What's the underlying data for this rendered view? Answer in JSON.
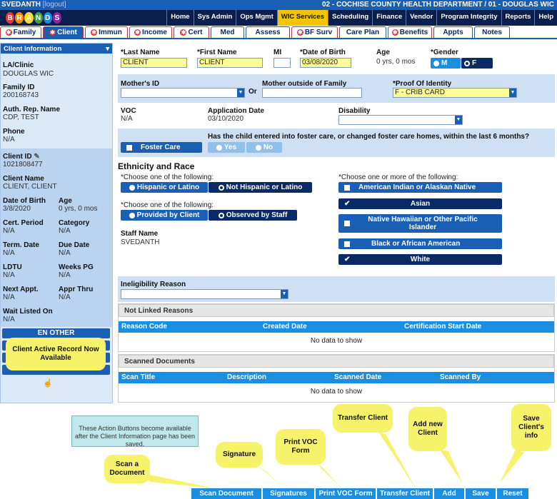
{
  "topbar": {
    "user": "SVEDANTH",
    "user_link": "[logout]",
    "org": "02 - COCHISE COUNTY HEALTH DEPARTMENT / 01 - DOUGLAS WIC"
  },
  "logo_letters": [
    "B",
    "R",
    "A",
    "N",
    "D",
    "S"
  ],
  "logo_colors": [
    "#e53935",
    "#fb8c00",
    "#fdd835",
    "#43a047",
    "#1e88e5",
    "#8e24aa"
  ],
  "mainnav": [
    "Home",
    "Sys Admin",
    "Ops Mgmt",
    "WIC Services",
    "Scheduling",
    "Finance",
    "Vendor",
    "Program Integrity",
    "Reports",
    "Help"
  ],
  "tabs": [
    {
      "label": "Family",
      "req": true
    },
    {
      "label": "Client",
      "req": true,
      "active": true
    },
    {
      "label": "Immun",
      "req": true
    },
    {
      "label": "Income",
      "req": true
    },
    {
      "label": "Cert",
      "req": true
    },
    {
      "label": "Med",
      "req": false
    },
    {
      "label": "Assess",
      "req": false
    },
    {
      "label": "BF Surv",
      "req": true
    },
    {
      "label": "Care Plan",
      "req": false
    },
    {
      "label": "Benefits",
      "req": true
    },
    {
      "label": "Appts",
      "req": false
    },
    {
      "label": "Notes",
      "req": false
    }
  ],
  "sidebar": {
    "title": "Client Information",
    "laclinic_label": "LA/Clinic",
    "laclinic": "DOUGLAS WIC",
    "familyid_label": "Family ID",
    "familyid": "200168743",
    "authrep_label": "Auth. Rep. Name",
    "authrep": "CDP, TEST",
    "phone_label": "Phone",
    "phone": "N/A",
    "clientid_label": "Client ID",
    "clientid": "1021808477",
    "clientname_label": "Client Name",
    "clientname": "CLIENT, CLIENT",
    "dob_label": "Date of Birth",
    "dob": "3/8/2020",
    "age_label": "Age",
    "age": "0 yrs, 0 mos",
    "certperiod_label": "Cert. Period",
    "certperiod": "N/A",
    "category_label": "Category",
    "category": "N/A",
    "termdate_label": "Term. Date",
    "termdate": "N/A",
    "duedate_label": "Due Date",
    "duedate": "N/A",
    "ldtu_label": "LDTU",
    "ldtu": "N/A",
    "weekspg_label": "Weeks PG",
    "weekspg": "N/A",
    "nextappt_label": "Next Appt.",
    "nextappt": "N/A",
    "apprthru_label": "Appr Thru",
    "apprthru": "N/A",
    "waitlist_label": "Wait Listed On",
    "waitlist": "N/A",
    "another_label": "EN   OTHER"
  },
  "form": {
    "lastname_label": "*Last Name",
    "lastname": "CLIENT",
    "firstname_label": "*First Name",
    "firstname": "CLIENT",
    "mi_label": "MI",
    "mi": "",
    "dob_label": "*Date of Birth",
    "dob": "03/08/2020",
    "age_label": "Age",
    "age": "0 yrs, 0 mos",
    "gender_label": "*Gender",
    "gender_m": "M",
    "gender_f": "F",
    "motherid_label": "Mother's ID",
    "or": "Or",
    "mother_outside_label": "Mother outside of Family",
    "proof_label": "*Proof Of Identity",
    "proof": "F - CRIB CARD",
    "voc_label": "VOC",
    "voc": "N/A",
    "appdate_label": "Application Date",
    "appdate": "03/10/2020",
    "disability_label": "Disability",
    "foster_btn": "Foster Care",
    "foster_q": "Has the child entered into foster care, or changed foster care homes, within the last 6 months?",
    "yes": "Yes",
    "no": "No",
    "ethnicity_title": "Ethnicity and Race",
    "choose_one_1": "*Choose one of the following:",
    "hispanic": "Hispanic or Latino",
    "not_hispanic": "Not Hispanic or Latino",
    "choose_one_2": "*Choose one of the following:",
    "provided": "Provided by Client",
    "observed": "Observed by Staff",
    "staffname_label": "Staff Name",
    "staffname": "SVEDANTH",
    "choose_more": "*Choose one or more of the following:",
    "race_aian": "American Indian or Alaskan Native",
    "race_asian": "Asian",
    "race_nhpi": "Native Hawaiian or Other Pacific Islander",
    "race_black": "Black or African American",
    "race_white": "White",
    "inelig_label": "Ineligibility Reason"
  },
  "notlinked": {
    "title": "Not Linked Reasons",
    "cols": [
      "Reason Code",
      "Created Date",
      "Certification Start Date"
    ],
    "empty": "No data to show"
  },
  "scanned": {
    "title": "Scanned Documents",
    "cols": [
      "Scan Title",
      "Description",
      "Scanned Date",
      "Scanned By"
    ],
    "empty": "No data to show"
  },
  "notebox": "These Action Buttons become available after the Client Information page has been saved.",
  "callouts": {
    "active_record": "Client Active Record Now Available",
    "scan": "Scan a Document",
    "signature": "Signature",
    "printvoc": "Print VOC Form",
    "transfer": "Transfer Client",
    "addnew": "Add new Client",
    "save": "Save Client's info"
  },
  "bottom": [
    "Scan Document",
    "Signatures",
    "Print VOC Form",
    "Transfer Client",
    "Add",
    "Save",
    "Reset"
  ]
}
